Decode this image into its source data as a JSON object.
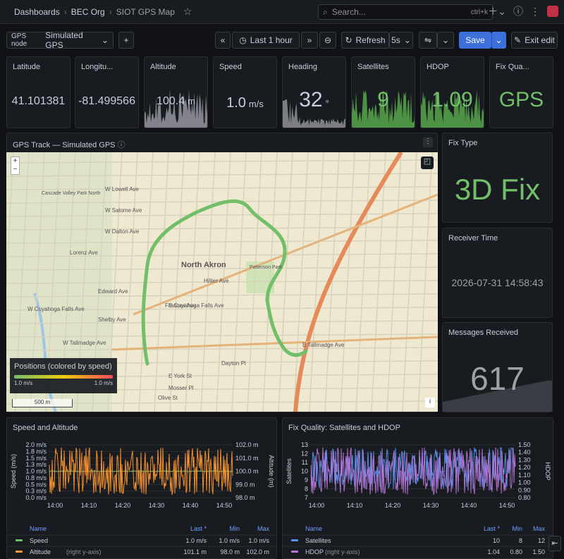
{
  "breadcrumb": [
    "Dashboards",
    "BEC Org",
    "SIOT GPS Map"
  ],
  "search": {
    "placeholder": "Search...",
    "shortcut": "ctrl+k"
  },
  "toolbar": {
    "variable_label": "GPS node",
    "variable_value": "Simulated GPS",
    "time_range": "Last 1 hour",
    "refresh_label": "Refresh",
    "refresh_interval": "5s",
    "save_label": "Save",
    "exit_label": "Exit edit"
  },
  "stats": [
    {
      "title": "Latitude",
      "value": "41.101381"
    },
    {
      "title": "Longitu...",
      "value": "-81.499566"
    },
    {
      "title": "Altitude",
      "value": "100.4",
      "unit": "m"
    },
    {
      "title": "Speed",
      "value": "1.0",
      "unit": "m/s"
    },
    {
      "title": "Heading",
      "value": "32",
      "unit": "°"
    },
    {
      "title": "Satellites",
      "value": "9"
    },
    {
      "title": "HDOP",
      "value": "1.09"
    },
    {
      "title": "Fix Qua...",
      "value": "GPS"
    }
  ],
  "map_panel": {
    "title": "GPS Track — Simulated GPS",
    "legend_title": "Positions (colored by speed)",
    "legend_min": "1.0 m/s",
    "legend_max": "1.0 m/s",
    "scale": "500 m",
    "labels": [
      "North Akron",
      "W Tallmadge Ave",
      "E Tallmadge Ave",
      "E Cuyahoga Falls Ave",
      "W Cuyahoga Falls Ave",
      "Cascade Valley Park North",
      "Dayton Pl",
      "E York St",
      "Mosser Pl",
      "Olive St",
      "Patterson Park",
      "Lorenz Ave",
      "Edward Ave",
      "Shelby Ave",
      "Frances Ave",
      "Hillier Ave",
      "W Lowell Ave",
      "W Salome Ave",
      "W Dalton Ave"
    ]
  },
  "fix_type": {
    "title": "Fix Type",
    "value": "3D Fix"
  },
  "receiver_time": {
    "title": "Receiver Time",
    "value": "2026-07-31 14:58:43"
  },
  "messages": {
    "title": "Messages Received",
    "value": "617"
  },
  "speed_alt": {
    "title": "Speed and Altitude",
    "yleft_label": "Speed (m/s)",
    "yright_label": "Altitude (m)",
    "yleft_ticks": [
      "2.0 m/s",
      "1.8 m/s",
      "1.5 m/s",
      "1.3 m/s",
      "1.0 m/s",
      "0.8 m/s",
      "0.5 m/s",
      "0.3 m/s",
      "0.0 m/s"
    ],
    "yright_ticks": [
      "102.0 m",
      "101.0 m",
      "100.0 m",
      "99.0 m",
      "98.0 m"
    ],
    "x_ticks": [
      "14:00",
      "14:10",
      "14:20",
      "14:30",
      "14:40",
      "14:50"
    ],
    "legend_headers": {
      "name": "Name",
      "last": "Last *",
      "min": "Min",
      "max": "Max"
    },
    "rows": [
      {
        "name": "Speed",
        "suffix": "",
        "last": "1.0 m/s",
        "min": "1.0 m/s",
        "max": "1.0 m/s",
        "color": "#73bf69"
      },
      {
        "name": "Altitude",
        "suffix": "(right y-axis)",
        "last": "101.1 m",
        "min": "98.0 m",
        "max": "102.0 m",
        "color": "#ff9830"
      }
    ]
  },
  "fix_quality": {
    "title": "Fix Quality: Satellites and HDOP",
    "yleft_label": "Satellites",
    "yright_label": "HDOP",
    "yleft_ticks": [
      "13",
      "12",
      "11",
      "10",
      "9",
      "8",
      "7"
    ],
    "yright_ticks": [
      "1.50",
      "1.40",
      "1.30",
      "1.20",
      "1.10",
      "1.00",
      "0.90",
      "0.80"
    ],
    "x_ticks": [
      "14:00",
      "14:10",
      "14:20",
      "14:30",
      "14:40",
      "14:50"
    ],
    "rows": [
      {
        "name": "Satellites",
        "suffix": "",
        "last": "10",
        "min": "8",
        "max": "12",
        "color": "#5794f2"
      },
      {
        "name": "HDOP",
        "suffix": "(right y-axis)",
        "last": "1.04",
        "min": "0.80",
        "max": "1.50",
        "color": "#b877d9"
      }
    ]
  }
}
